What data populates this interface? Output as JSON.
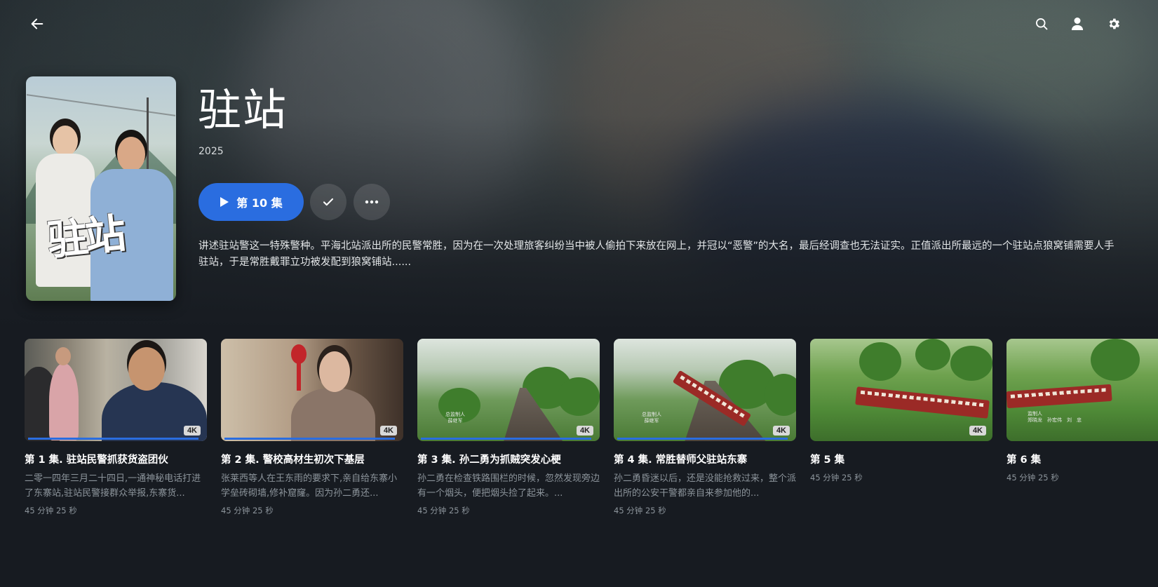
{
  "topbar": {
    "back_icon": "arrow-left-icon",
    "search_icon": "search-icon",
    "user_icon": "user-icon",
    "settings_icon": "gear-icon"
  },
  "show": {
    "title": "驻站",
    "year": "2025",
    "poster_text": "驻站",
    "play_label": "第 10 集",
    "overview": "讲述驻站警这一特殊警种。平海北站派出所的民警常胜，因为在一次处理旅客纠纷当中被人偷拍下来放在网上，并冠以“恶警”的大名，最后经调查也无法证实。正值派出所最远的一个驻站点狼窝铺需要人手驻站，于是常胜戴罪立功被发配到狼窝铺站......"
  },
  "colors": {
    "accent": "#2a6de0",
    "background": "#171b21",
    "muted_text": "#8c949b"
  },
  "episodes": [
    {
      "title": "第 1 集. 驻站民警抓获货盗团伙",
      "description": "二零一四年三月二十四日,一通神秘电话打进 了东寨站,驻站民警接群众举报,东寨货...",
      "duration": "45 分钟 25 秒",
      "badge": "4K",
      "progress": 1.0,
      "credit_1": "",
      "credit_2": ""
    },
    {
      "title": "第 2 集. 警校高材生初次下基层",
      "description": "张莱西等人在王东雨的要求下,亲自给东寨小学垒砖砌墙,修补窟窿。因为孙二勇还...",
      "duration": "45 分钟 25 秒",
      "badge": "4K",
      "progress": 1.0,
      "credit_1": "",
      "credit_2": ""
    },
    {
      "title": "第 3 集. 孙二勇为抓贼突发心梗",
      "description": "孙二勇在检查铁路围栏的时候，忽然发现旁边有一个烟头，便把烟头捡了起来。...",
      "duration": "45 分钟 25 秒",
      "badge": "4K",
      "progress": 1.0,
      "credit_1": "总监制人",
      "credit_2": "薛继军"
    },
    {
      "title": "第 4 集. 常胜替师父驻站东寨",
      "description": "孙二勇昏迷以后，还是没能抢救过来，整个派出所的公安干警都亲自来参加他的...",
      "duration": "45 分钟 25 秒",
      "badge": "4K",
      "progress": 1.0,
      "credit_1": "总监制人",
      "credit_2": "薛继军"
    },
    {
      "title": "第 5 集",
      "description": "",
      "duration": "45 分钟 25 秒",
      "badge": "4K",
      "progress": 0,
      "credit_1": "",
      "credit_2": ""
    },
    {
      "title": "第 6 集",
      "description": "",
      "duration": "45 分钟 25 秒",
      "badge": "",
      "progress": 0,
      "credit_1": "监制人",
      "credit_2": "郑晓龙　孙宏伟　刘　忠"
    }
  ]
}
